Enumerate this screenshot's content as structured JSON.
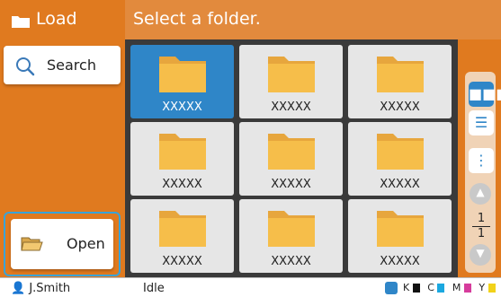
{
  "header": {
    "title": "Load",
    "message": "Select a folder."
  },
  "left": {
    "search_label": "Search",
    "open_label": "Open"
  },
  "folders": [
    {
      "label": "XXXXX"
    },
    {
      "label": "XXXXX"
    },
    {
      "label": "XXXXX"
    },
    {
      "label": "XXXXX"
    },
    {
      "label": "XXXXX"
    },
    {
      "label": "XXXXX"
    },
    {
      "label": "XXXXX"
    },
    {
      "label": "XXXXX"
    },
    {
      "label": "XXXXX"
    }
  ],
  "pager": {
    "current": "1",
    "total": "1"
  },
  "status": {
    "user": "J.Smith",
    "state": "Idle",
    "inks": [
      "K",
      "C",
      "M",
      "Y"
    ]
  },
  "colors": {
    "header_dark": "#e07a1f",
    "header_light": "#e28a3d",
    "accent": "#2f86c8",
    "ink_k": "#111111",
    "ink_c": "#1ba8e0",
    "ink_m": "#d63c9c",
    "ink_y": "#f2d21a"
  },
  "icons": {
    "header_folder": "folder-icon",
    "search": "search-icon",
    "open": "open-folder-icon",
    "view_grid": "grid-view-icon",
    "view_list": "list-view-icon",
    "more": "more-vertical-icon",
    "up": "chevron-up-icon",
    "down": "chevron-down-icon",
    "user": "user-icon",
    "ink": "ink-icon"
  }
}
